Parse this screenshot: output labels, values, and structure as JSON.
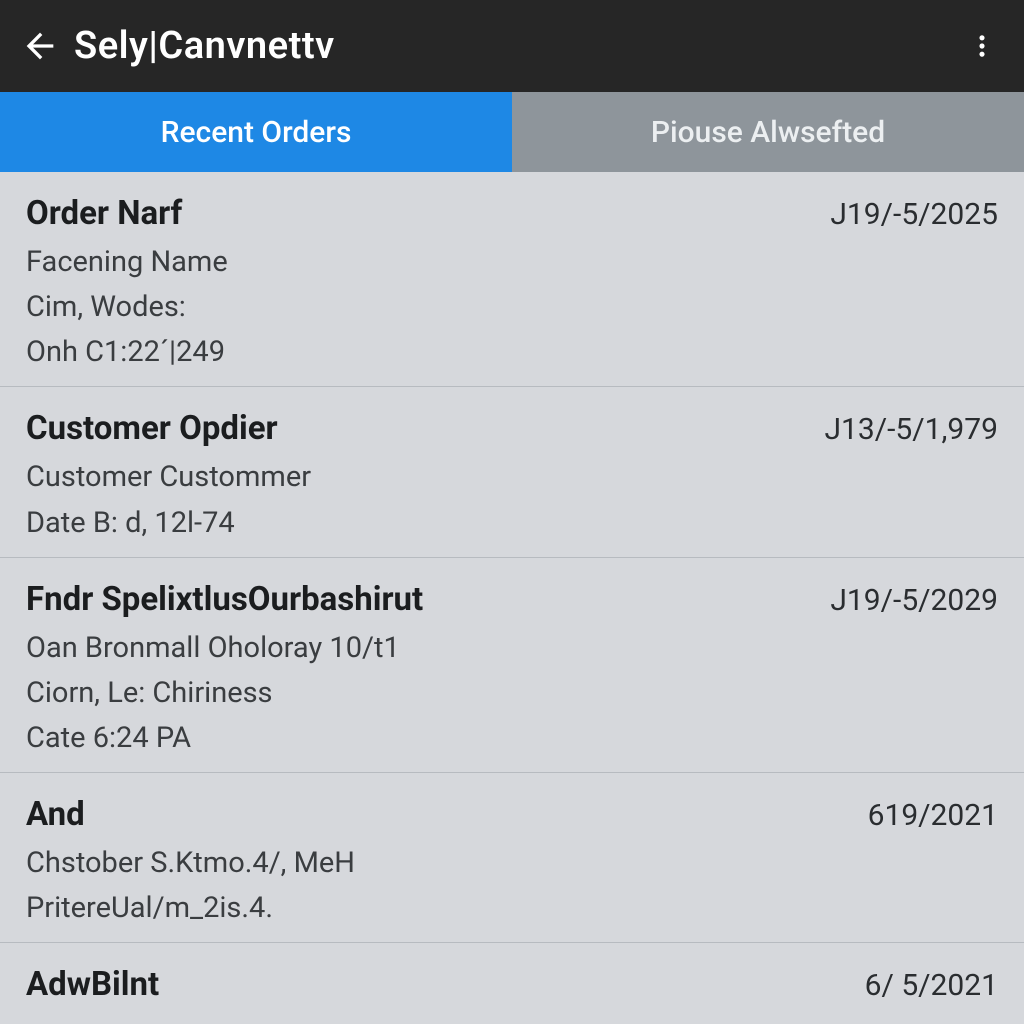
{
  "appbar": {
    "title": "Sely|Canvnettv"
  },
  "tabs": {
    "recent": "Recent Orders",
    "other": "Piouse Alwsefted"
  },
  "orders": [
    {
      "title": "Order Narf",
      "date": "J19/-5/2025",
      "lines": [
        "Facening Name",
        "Cim, Wodes:",
        "Onh C1:22´|249"
      ]
    },
    {
      "title": "Customer Opdier",
      "date": "J13/-5/1,979",
      "lines": [
        "Customer Custommer",
        "Date B:  d, 12l-74"
      ]
    },
    {
      "title": "Fndr SpelixtlusOurbashirut",
      "date": "J19/-5/2029",
      "lines": [
        "Oan Bronmall Oholoray 10/t1",
        "Ciorn, Le: Chiriness",
        "Cate 6:24  PA"
      ]
    },
    {
      "title": "And",
      "date": "619/2021",
      "lines": [
        "Chstober S.Ktmo.4/, MeH",
        "PritereUal/m_2is.4."
      ]
    },
    {
      "title": "AdwBilnt",
      "date": "6/ 5/2021",
      "lines": []
    }
  ]
}
